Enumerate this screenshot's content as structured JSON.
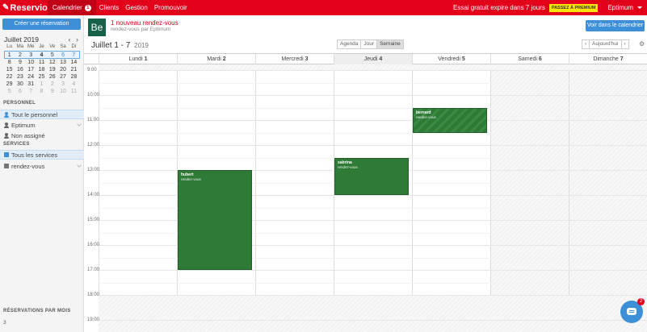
{
  "topbar": {
    "brand": "Reservio",
    "nav": [
      {
        "label": "Calendrier",
        "badge": "1",
        "active": true
      },
      {
        "label": "Clients"
      },
      {
        "label": "Gestion"
      },
      {
        "label": "Promouvoir"
      }
    ],
    "trial_text": "Essai gratuit expire dans 7 jours",
    "premium_label": "PASSEZ À PREMIUM",
    "user": "Eptimum"
  },
  "sidebar": {
    "create_label": "Créer une réservation",
    "mini_title": "Juillet 2019",
    "mini_nav": "‹ ›",
    "weekdays": [
      "Lu",
      "Ma",
      "Me",
      "Je",
      "Ve",
      "Sa",
      "Di"
    ],
    "weeks": [
      [
        "1",
        "2",
        "3",
        "4",
        "5",
        "6",
        "7"
      ],
      [
        "8",
        "9",
        "10",
        "11",
        "12",
        "13",
        "14"
      ],
      [
        "15",
        "16",
        "17",
        "18",
        "19",
        "20",
        "21"
      ],
      [
        "22",
        "23",
        "24",
        "25",
        "26",
        "27",
        "28"
      ],
      [
        "29",
        "30",
        "31",
        "1",
        "2",
        "3",
        "4"
      ],
      [
        "5",
        "6",
        "7",
        "8",
        "9",
        "10",
        "11"
      ]
    ],
    "staff_header": "PERSONNEL",
    "staff_all": "Tout le personnel",
    "staff_items": [
      "Eptimum",
      "Non assigné"
    ],
    "services_header": "SERVICES",
    "services_all": "Tous les services",
    "services_items": [
      "rendez-vous"
    ],
    "stats_title": "RÉSERVATIONS PAR MOIS",
    "stats_value": "3"
  },
  "notification": {
    "avatar": "Be",
    "title": "1 nouveau rendez-vous",
    "subtitle": "rendez-vous par Eptimum",
    "view_button": "Voir dans le calendrier"
  },
  "toolbar": {
    "range": "Juillet 1 - 7",
    "year": "2019",
    "views": [
      "Agenda",
      "Jour",
      "Semaine"
    ],
    "prev": "‹",
    "today": "Aujourd'hui",
    "next": "›",
    "settings_icon": "⚙"
  },
  "days": [
    {
      "name": "Lundi",
      "num": "1"
    },
    {
      "name": "Mardi",
      "num": "2"
    },
    {
      "name": "Mercredi",
      "num": "3"
    },
    {
      "name": "Jeudi",
      "num": "4"
    },
    {
      "name": "Vendredi",
      "num": "5"
    },
    {
      "name": "Samedi",
      "num": "6"
    },
    {
      "name": "Dimanche",
      "num": "7"
    }
  ],
  "hours": [
    "9:00",
    "10:00",
    "11:00",
    "12:00",
    "13:00",
    "14:00",
    "15:00",
    "16:00",
    "17:00",
    "18:00",
    "19:00"
  ],
  "events": [
    {
      "name": "hubert",
      "service": "rendez-vous",
      "day": 1,
      "start": "13:00",
      "end": "17:00",
      "striped": false
    },
    {
      "name": "sabrina",
      "service": "rendez-vous",
      "day": 3,
      "start": "12:30",
      "end": "14:00",
      "striped": false
    },
    {
      "name": "bernard",
      "service": "rendez-vous",
      "day": 4,
      "start": "10:30",
      "end": "11:30",
      "striped": true
    }
  ],
  "chat": {
    "badge": "2"
  },
  "colors": {
    "brand": "#e3001b",
    "primary": "#3d8fd8",
    "event": "#2f7a37"
  }
}
